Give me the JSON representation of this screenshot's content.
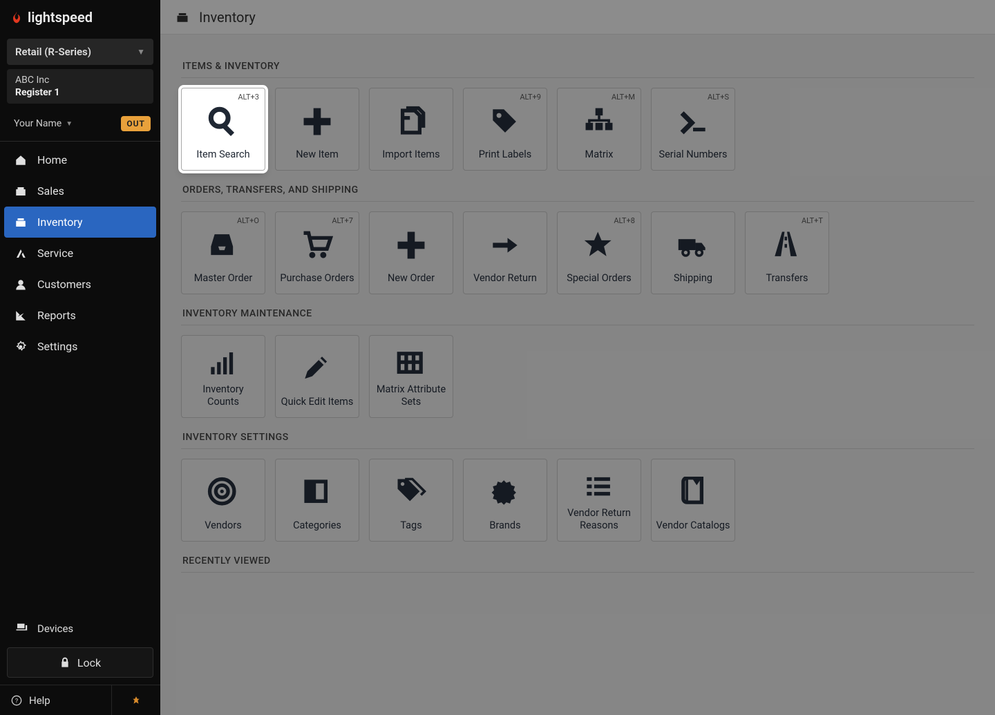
{
  "brand": "lightspeed",
  "product_selector": "Retail (R-Series)",
  "company": {
    "name": "ABC Inc",
    "register": "Register 1"
  },
  "user": {
    "name": "Your Name",
    "badge": "OUT"
  },
  "nav": [
    {
      "label": "Home",
      "icon": "home"
    },
    {
      "label": "Sales",
      "icon": "sales"
    },
    {
      "label": "Inventory",
      "icon": "inventory",
      "active": true
    },
    {
      "label": "Service",
      "icon": "service"
    },
    {
      "label": "Customers",
      "icon": "customers"
    },
    {
      "label": "Reports",
      "icon": "reports"
    },
    {
      "label": "Settings",
      "icon": "settings"
    }
  ],
  "bottom": {
    "devices": "Devices",
    "lock": "Lock",
    "help": "Help"
  },
  "page": {
    "title": "Inventory",
    "sections": [
      {
        "title": "ITEMS & INVENTORY",
        "tiles": [
          {
            "label": "Item Search",
            "shortcut": "ALT+3",
            "icon": "search",
            "highlight": true
          },
          {
            "label": "New Item",
            "icon": "plus"
          },
          {
            "label": "Import Items",
            "icon": "import"
          },
          {
            "label": "Print Labels",
            "shortcut": "ALT+9",
            "icon": "tag"
          },
          {
            "label": "Matrix",
            "shortcut": "ALT+M",
            "icon": "matrix"
          },
          {
            "label": "Serial Numbers",
            "shortcut": "ALT+S",
            "icon": "serial"
          }
        ]
      },
      {
        "title": "ORDERS, TRANSFERS, AND SHIPPING",
        "tiles": [
          {
            "label": "Master Order",
            "shortcut": "ALT+O",
            "icon": "inbox"
          },
          {
            "label": "Purchase Orders",
            "shortcut": "ALT+7",
            "icon": "cart"
          },
          {
            "label": "New Order",
            "icon": "plus"
          },
          {
            "label": "Vendor Return",
            "icon": "arrow-right"
          },
          {
            "label": "Special Orders",
            "shortcut": "ALT+8",
            "icon": "star"
          },
          {
            "label": "Shipping",
            "icon": "truck"
          },
          {
            "label": "Transfers",
            "shortcut": "ALT+T",
            "icon": "road"
          }
        ]
      },
      {
        "title": "INVENTORY MAINTENANCE",
        "tiles": [
          {
            "label": "Inventory Counts",
            "icon": "bars"
          },
          {
            "label": "Quick Edit Items",
            "icon": "pencil"
          },
          {
            "label": "Matrix Attribute Sets",
            "icon": "grid"
          }
        ]
      },
      {
        "title": "INVENTORY SETTINGS",
        "tiles": [
          {
            "label": "Vendors",
            "icon": "target"
          },
          {
            "label": "Categories",
            "icon": "columns"
          },
          {
            "label": "Tags",
            "icon": "tags"
          },
          {
            "label": "Brands",
            "icon": "certificate"
          },
          {
            "label": "Vendor Return Reasons",
            "icon": "list"
          },
          {
            "label": "Vendor Catalogs",
            "icon": "book"
          }
        ]
      },
      {
        "title": "RECENTLY VIEWED",
        "tiles": []
      }
    ]
  }
}
